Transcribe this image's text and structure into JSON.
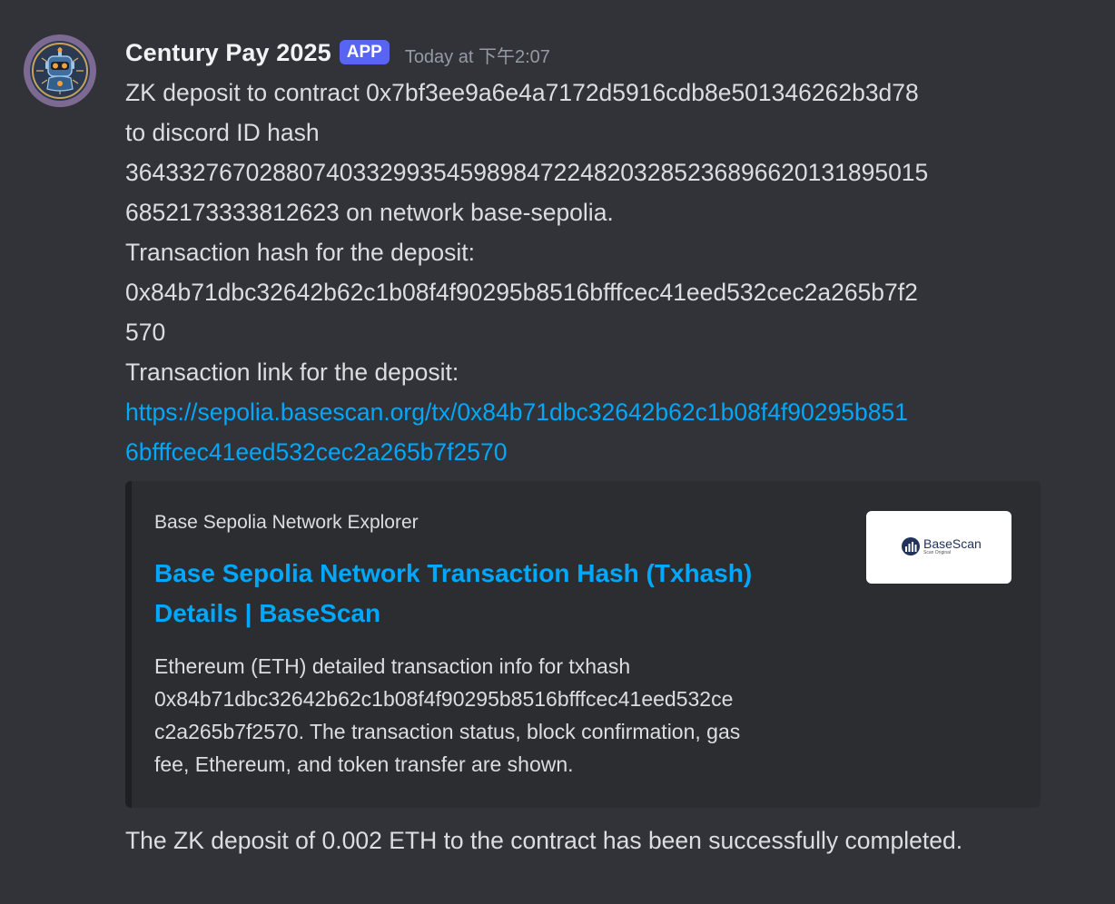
{
  "message": {
    "author": "Century Pay 2025",
    "badge": "APP",
    "timestamp": "Today at 下午2:07",
    "lines": [
      "ZK deposit to contract 0x7bf3ee9a6e4a7172d5916cdb8e501346262b3d78",
      "to discord ID hash",
      "364332767028807403329935459898472248203285236896620131895015",
      "6852173333812623 on network base-sepolia.",
      "Transaction hash for the deposit:",
      "0x84b71dbc32642b62c1b08f4f90295b8516bfffcec41eed532cec2a265b7f2",
      "570",
      "Transaction link for the deposit:"
    ],
    "link_line1": "https://sepolia.basescan.org/tx/0x84b71dbc32642b62c1b08f4f90295b851",
    "link_line2": "6bfffcec41eed532cec2a265b7f2570",
    "footer": "The ZK deposit of 0.002 ETH to the contract has been successfully completed."
  },
  "embed": {
    "provider": "Base Sepolia Network Explorer",
    "title_line1": "Base Sepolia Network Transaction Hash (Txhash)",
    "title_line2": "Details | BaseScan",
    "description_lines": [
      "Ethereum (ETH) detailed transaction info for txhash",
      "0x84b71dbc32642b62c1b08f4f90295b8516bfffcec41eed532ce",
      "c2a265b7f2570. The transaction status, block confirmation, gas",
      "fee, Ethereum, and token transfer are shown."
    ],
    "thumbnail": {
      "name": "BaseScan",
      "sub": "Scan Original",
      "icon": "basescan-logo-icon"
    }
  },
  "colors": {
    "background": "#313338",
    "embed_background": "#2b2d31",
    "link": "#00a8fc",
    "badge": "#5865f2",
    "text": "#dbdee1",
    "muted": "#949ba4"
  }
}
